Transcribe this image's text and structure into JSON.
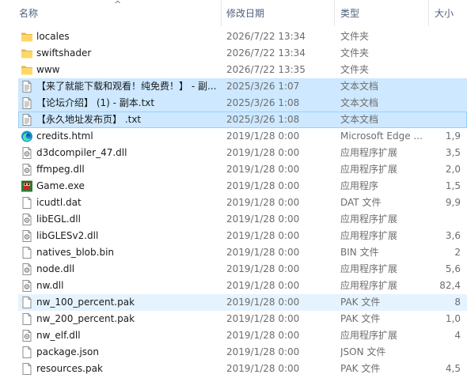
{
  "columns": {
    "name": "名称",
    "date": "修改日期",
    "type": "类型",
    "size": "大小"
  },
  "sort_indicator": "^",
  "files": [
    {
      "icon": "folder",
      "name": "locales",
      "date": "2026/7/22 13:34",
      "type": "文件夹",
      "size": "",
      "state": "normal"
    },
    {
      "icon": "folder",
      "name": "swiftshader",
      "date": "2026/7/22 13:34",
      "type": "文件夹",
      "size": "",
      "state": "normal"
    },
    {
      "icon": "folder",
      "name": "www",
      "date": "2026/7/22 13:35",
      "type": "文件夹",
      "size": "",
      "state": "normal"
    },
    {
      "icon": "text-doc",
      "name": "【来了就能下载和观看！纯免费！】 - 副...",
      "date": "2025/3/26 1:07",
      "type": "文本文档",
      "size": "",
      "state": "selected"
    },
    {
      "icon": "text-doc",
      "name": "【论坛介绍】 (1) - 副本.txt",
      "date": "2025/3/26 1:08",
      "type": "文本文档",
      "size": "",
      "state": "selected"
    },
    {
      "icon": "text-doc",
      "name": "【永久地址发布页】 .txt",
      "date": "2025/3/26 1:08",
      "type": "文本文档",
      "size": "",
      "state": "selected-focused"
    },
    {
      "icon": "edge",
      "name": "credits.html",
      "date": "2019/1/28 0:00",
      "type": "Microsoft Edge ...",
      "size": "1,9",
      "state": "normal"
    },
    {
      "icon": "dll",
      "name": "d3dcompiler_47.dll",
      "date": "2019/1/28 0:00",
      "type": "应用程序扩展",
      "size": "3,5",
      "state": "normal"
    },
    {
      "icon": "dll",
      "name": "ffmpeg.dll",
      "date": "2019/1/28 0:00",
      "type": "应用程序扩展",
      "size": "2,0",
      "state": "normal"
    },
    {
      "icon": "game",
      "name": "Game.exe",
      "date": "2019/1/28 0:00",
      "type": "应用程序",
      "size": "1,5",
      "state": "normal"
    },
    {
      "icon": "blank-file",
      "name": "icudtl.dat",
      "date": "2019/1/28 0:00",
      "type": "DAT 文件",
      "size": "9,9",
      "state": "normal"
    },
    {
      "icon": "dll",
      "name": "libEGL.dll",
      "date": "2019/1/28 0:00",
      "type": "应用程序扩展",
      "size": "",
      "state": "normal"
    },
    {
      "icon": "dll",
      "name": "libGLESv2.dll",
      "date": "2019/1/28 0:00",
      "type": "应用程序扩展",
      "size": "3,6",
      "state": "normal"
    },
    {
      "icon": "blank-file",
      "name": "natives_blob.bin",
      "date": "2019/1/28 0:00",
      "type": "BIN 文件",
      "size": "2",
      "state": "normal"
    },
    {
      "icon": "dll",
      "name": "node.dll",
      "date": "2019/1/28 0:00",
      "type": "应用程序扩展",
      "size": "5,6",
      "state": "normal"
    },
    {
      "icon": "dll",
      "name": "nw.dll",
      "date": "2019/1/28 0:00",
      "type": "应用程序扩展",
      "size": "82,4",
      "state": "normal"
    },
    {
      "icon": "blank-file",
      "name": "nw_100_percent.pak",
      "date": "2019/1/28 0:00",
      "type": "PAK 文件",
      "size": "8",
      "state": "hover"
    },
    {
      "icon": "blank-file",
      "name": "nw_200_percent.pak",
      "date": "2019/1/28 0:00",
      "type": "PAK 文件",
      "size": "1,0",
      "state": "normal"
    },
    {
      "icon": "dll",
      "name": "nw_elf.dll",
      "date": "2019/1/28 0:00",
      "type": "应用程序扩展",
      "size": "4",
      "state": "normal"
    },
    {
      "icon": "blank-file",
      "name": "package.json",
      "date": "2019/1/28 0:00",
      "type": "JSON 文件",
      "size": "",
      "state": "normal"
    },
    {
      "icon": "blank-file",
      "name": "resources.pak",
      "date": "2019/1/28 0:00",
      "type": "PAK 文件",
      "size": "4,5",
      "state": "normal"
    }
  ]
}
